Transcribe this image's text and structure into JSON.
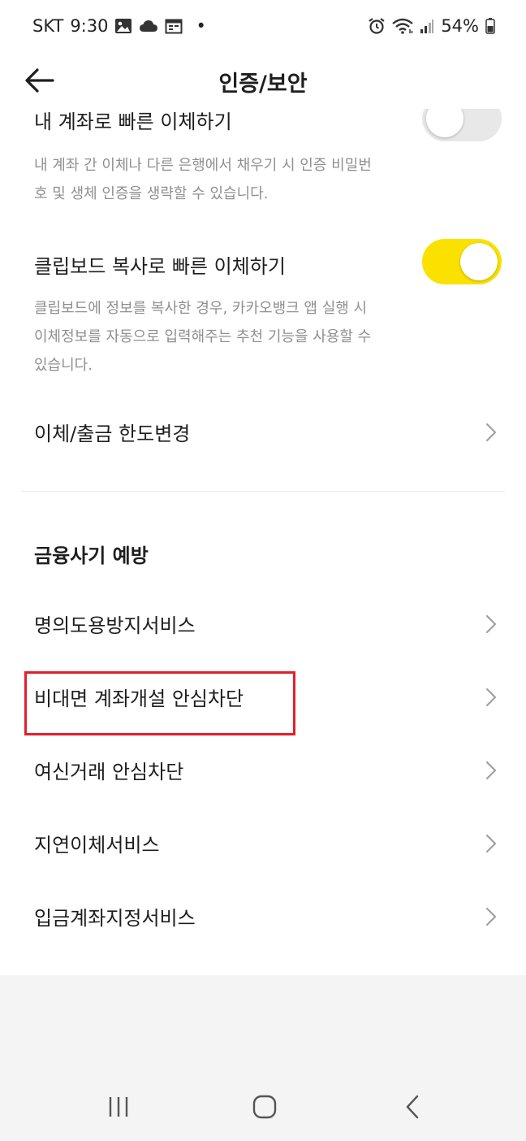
{
  "status_bar": {
    "carrier": "SKT",
    "time": "9:30",
    "dot": "•",
    "battery_percent": "54%",
    "left_icons": [
      "gallery-icon",
      "cloud-icon",
      "calendar-icon"
    ],
    "right_icons": [
      "alarm-icon",
      "wifi-icon",
      "signal-icon",
      "battery-icon"
    ]
  },
  "header": {
    "title": "인증/보안",
    "back_icon": "arrow-left-icon"
  },
  "settings": [
    {
      "title": "내 계좌로 빠른 이체하기",
      "description": "내 계좌 간 이체나 다른 은행에서 채우기 시 인증 비밀번호 및 생체 인증을 생략할 수 있습니다.",
      "enabled": false
    },
    {
      "title": "클립보드 복사로 빠른 이체하기",
      "description": "클립보드에 정보를 복사한 경우, 카카오뱅크 앱 실행 시 이체정보를 자동으로 입력해주는 추천 기능을 사용할 수 있습니다.",
      "enabled": true
    }
  ],
  "limit_item": {
    "label": "이체/출금 한도변경"
  },
  "fraud_section": {
    "title": "금융사기 예방",
    "items": [
      {
        "label": "명의도용방지서비스"
      },
      {
        "label": "비대면 계좌개설 안심차단"
      },
      {
        "label": "여신거래 안심차단"
      },
      {
        "label": "지연이체서비스"
      },
      {
        "label": "입금계좌지정서비스"
      }
    ]
  },
  "colors": {
    "toggle_on": "#fae100",
    "toggle_off": "#e8e8e8",
    "highlight": "#e0202b",
    "text_primary": "#1e1e1e",
    "text_secondary": "#8f8f8f"
  },
  "nav_bar": {
    "icons": [
      "recent-apps-icon",
      "home-icon",
      "back-icon"
    ]
  }
}
